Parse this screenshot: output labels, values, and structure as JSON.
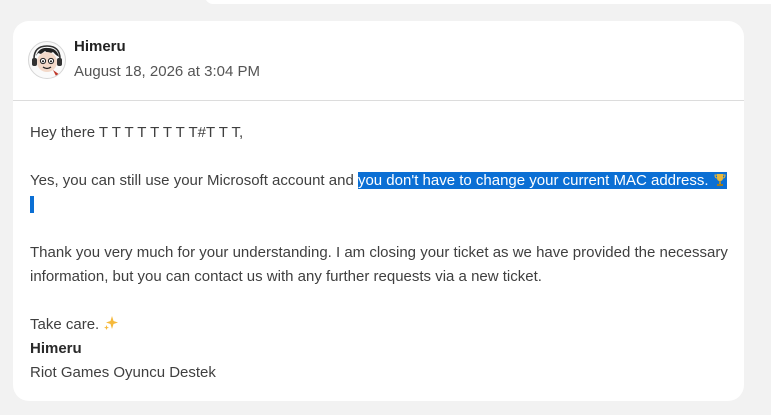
{
  "author": {
    "name": "Himeru",
    "timestamp": "August 18, 2026 at 3:04 PM"
  },
  "message": {
    "greeting": "Hey there T T T T T T T T#T T T,",
    "line2_plain": "Yes, you can still use your Microsoft account and ",
    "line2_highlighted": "you don't have to change your current MAC address.",
    "line3": "Thank you very much for your understanding. I am closing your ticket as we have provided the necessary information, but you can contact us with any further requests via a new ticket.",
    "closing": "Take care.",
    "signature_name": "Himeru",
    "signature_org": "Riot Games Oyuncu Destek"
  },
  "icons": {
    "avatar": "avatar-cartoon-icon",
    "trophy": "trophy-icon",
    "sparkles": "sparkles-icon"
  },
  "colors": {
    "highlight": "#0b6fd4",
    "page_background": "#f2f2f2",
    "card_background": "#ffffff"
  }
}
